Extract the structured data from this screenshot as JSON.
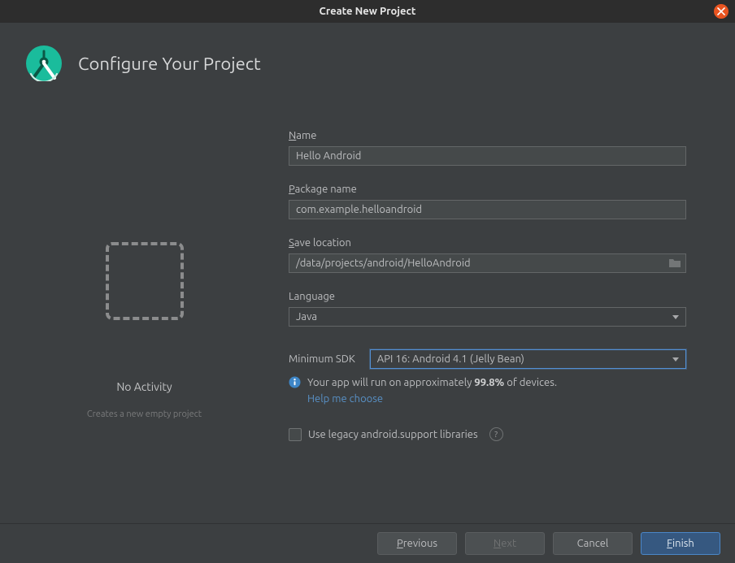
{
  "window": {
    "title": "Create New Project"
  },
  "header": {
    "heading": "Configure Your Project"
  },
  "left": {
    "title": "No Activity",
    "subtitle": "Creates a new empty project"
  },
  "form": {
    "name": {
      "label_prefix": "N",
      "label_rest": "ame",
      "value": "Hello Android"
    },
    "package": {
      "label_prefix": "P",
      "label_rest": "ackage name",
      "value": "com.example.helloandroid"
    },
    "save": {
      "label_prefix": "S",
      "label_rest": "ave location",
      "value": "/data/projects/android/HelloAndroid"
    },
    "language": {
      "label": "Language",
      "value": "Java"
    },
    "sdk": {
      "label": "Minimum SDK",
      "value": "API 16: Android 4.1 (Jelly Bean)"
    },
    "info": {
      "line_pre": "Your app will run on approximately ",
      "percent": "99.8%",
      "line_post": " of devices.",
      "link": "Help me choose"
    },
    "legacy": {
      "label": "Use legacy android.support libraries",
      "checked": false
    }
  },
  "footer": {
    "previous_pre": "P",
    "previous_rest": "revious",
    "next_pre": "N",
    "next_rest": "ext",
    "cancel": "Cancel",
    "finish_pre": "F",
    "finish_rest": "inish"
  }
}
